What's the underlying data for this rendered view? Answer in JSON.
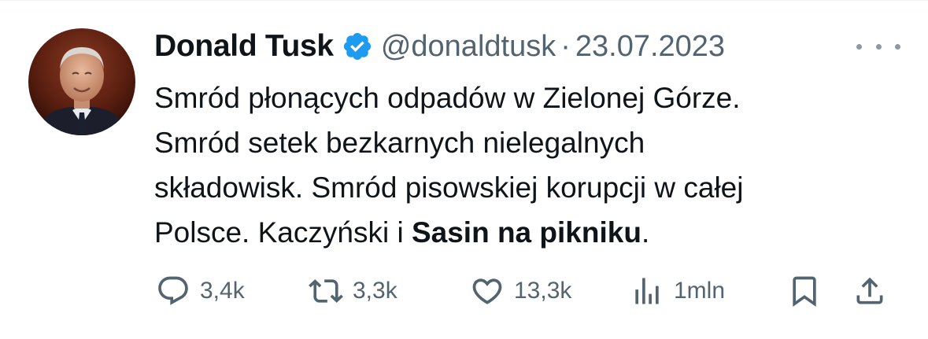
{
  "tweet": {
    "author": {
      "name": "Donald Tusk",
      "handle": "@donaldtusk",
      "separator": "·",
      "date": "23.07.2023",
      "verified": true,
      "avatar_icon": "profile-photo"
    },
    "text": {
      "line1": "Smród płonących odpadów w Zielonej Górze.",
      "line2": "Smród setek bezkarnych nielegalnych",
      "line3": "składowisk. Smród pisowskiej korupcji w całej",
      "line4_prefix": "Polsce. Kaczyński i ",
      "line4_bold": "Sasin na pikniku",
      "line4_suffix": "."
    },
    "actions": {
      "replies": "3,4k",
      "retweets": "3,3k",
      "likes": "13,3k",
      "views": "1mln"
    },
    "icons": {
      "more": "more-horizontal-icon",
      "reply": "reply-icon",
      "retweet": "retweet-icon",
      "like": "heart-icon",
      "views": "analytics-icon",
      "bookmark": "bookmark-icon",
      "share": "share-icon"
    },
    "colors": {
      "text": "#0f1419",
      "secondary": "#536471",
      "verified": "#1d9bf0"
    }
  }
}
